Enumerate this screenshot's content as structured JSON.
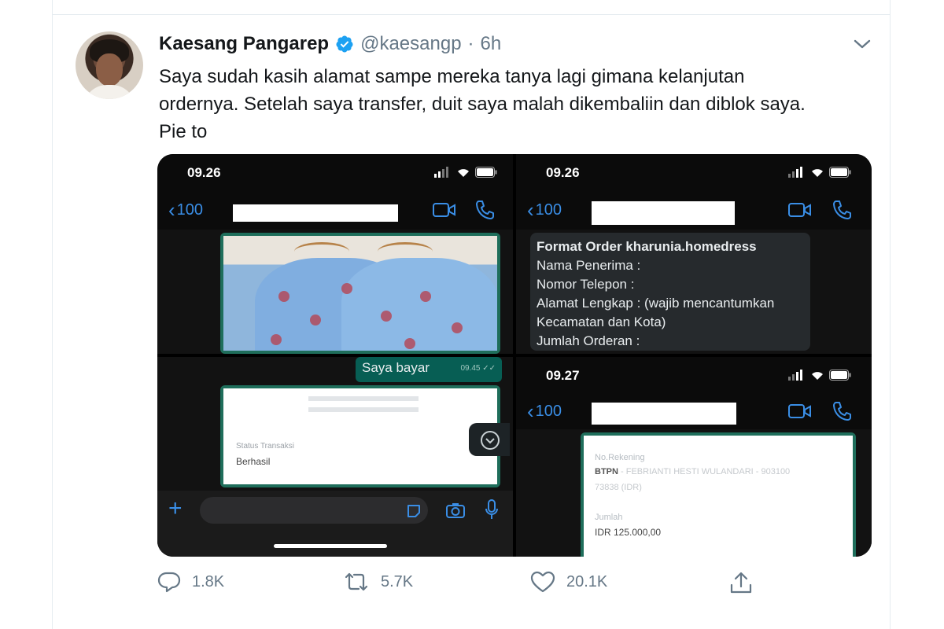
{
  "tweet": {
    "author_name": "Kaesang Pangarep",
    "handle": "@kaesangp",
    "separator": "·",
    "time": "6h",
    "text_lines": [
      "Saya sudah kasih alamat sampe mereka tanya lagi gimana kelanjutan",
      "ordernya. Setelah saya transfer, duit saya malah dikembaliin dan diblok saya.",
      "Pie to"
    ],
    "actions": {
      "reply_count": "1.8K",
      "retweet_count": "5.7K",
      "like_count": "20.1K"
    }
  },
  "media": {
    "panel1": {
      "time": "09.26",
      "back_count": "100"
    },
    "panel2": {
      "time": "09.26",
      "back_count": "100",
      "message_lines": [
        "Format Order kharunia.homedress",
        "Nama Penerima :",
        "Nomor Telepon :",
        "Alamat Lengkap : (wajib mencantumkan",
        "Kecamatan dan Kota)",
        "Jumlah Orderan :"
      ]
    },
    "panel3": {
      "bubble_text": "Saya bayar",
      "receipt_status_label": "Status Transaksi",
      "receipt_status_value": "Berhasil"
    },
    "panel4": {
      "time": "09.27",
      "back_count": "100",
      "account_label": "No.Rekening",
      "account_value": "BTPN - FEBRIANTI HESTI WULANDARI - 903100",
      "account_value_2": "73838 (IDR)",
      "amount_label": "Jumlah",
      "amount_value": "IDR 125.000,00"
    }
  },
  "colors": {
    "accent_blue": "#1da1f2",
    "ios_blue": "#3a8ee6",
    "whatsapp_green": "#075e54",
    "text_secondary": "#657786"
  },
  "icons": [
    "verified-badge-icon",
    "chevron-down-icon",
    "reply-icon",
    "retweet-icon",
    "like-icon",
    "share-icon",
    "video-call-icon",
    "phone-icon",
    "camera-icon",
    "mic-icon",
    "sticker-icon"
  ]
}
